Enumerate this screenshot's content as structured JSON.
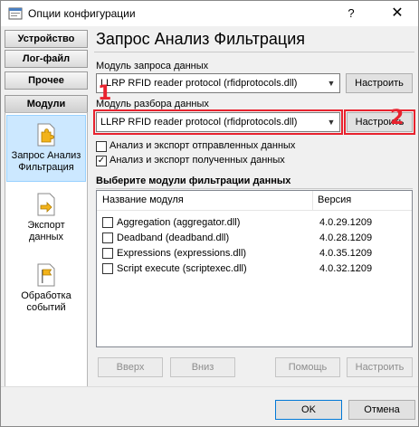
{
  "window": {
    "title": "Опции конфигурации",
    "help_glyph": "?",
    "close_glyph": "✕"
  },
  "nav": {
    "tabs": [
      {
        "label": "Устройство"
      },
      {
        "label": "Лог-файл"
      },
      {
        "label": "Прочее"
      },
      {
        "label": "Модули"
      }
    ],
    "items": [
      {
        "label_line1": "Запрос Анализ",
        "label_line2": "Фильтрация",
        "icon": "puzzle-icon"
      },
      {
        "label_line1": "Экспорт",
        "label_line2": "данных",
        "icon": "export-document-icon"
      },
      {
        "label_line1": "Обработка",
        "label_line2": "событий",
        "icon": "flag-document-icon"
      }
    ]
  },
  "main": {
    "heading": "Запрос Анализ Фильтрация",
    "request_module": {
      "label": "Модуль запроса данных",
      "value": "LLRP RFID reader protocol (rfidprotocols.dll)",
      "configure_label": "Настроить"
    },
    "parse_module": {
      "label": "Модуль разбора данных",
      "value": "LLRP RFID reader protocol (rfidprotocols.dll)",
      "configure_label": "Настроить"
    },
    "checkboxes": [
      {
        "label": "Анализ и экспорт отправленных данных",
        "checked": false
      },
      {
        "label": "Анализ и экспорт полученных данных",
        "checked": true
      }
    ],
    "check_mark": "✓",
    "filter_section": {
      "title": "Выберите модули фильтрации данных",
      "columns": [
        "Название модуля",
        "Версия"
      ],
      "rows": [
        {
          "name": "Aggregation (aggregator.dll)",
          "version": "4.0.29.1209"
        },
        {
          "name": "Deadband (deadband.dll)",
          "version": "4.0.28.1209"
        },
        {
          "name": "Expressions (expressions.dll)",
          "version": "4.0.35.1209"
        },
        {
          "name": "Script execute (scriptexec.dll)",
          "version": "4.0.32.1209"
        }
      ]
    },
    "list_buttons": {
      "up": "Вверх",
      "down": "Вниз",
      "help": "Помощь",
      "configure": "Настроить"
    },
    "annotations": {
      "marker1": "1",
      "marker2": "2",
      "color": "#e8222e"
    }
  },
  "footer": {
    "ok": "OK",
    "cancel": "Отмена"
  },
  "colors": {
    "selection_bg": "#cce8ff",
    "accent_border": "#0078d7"
  }
}
